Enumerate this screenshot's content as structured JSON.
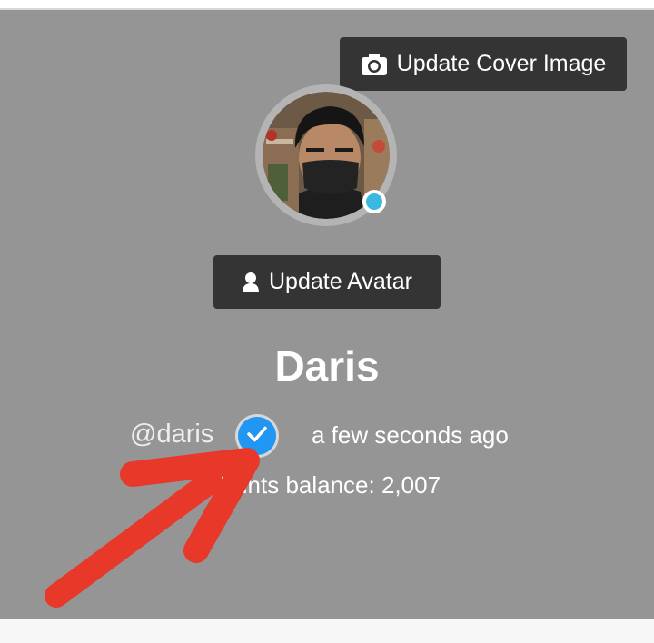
{
  "profile": {
    "display_name": "Daris",
    "handle": "@daris",
    "last_active": "a few seconds ago",
    "points_text": "Points balance: 2,007",
    "online_status": "online"
  },
  "buttons": {
    "update_cover": "Update Cover Image",
    "update_avatar": "Update Avatar"
  },
  "icons": {
    "cover_button_icon": "camera-icon",
    "avatar_button_icon": "user-icon",
    "verified_icon": "check-icon"
  },
  "colors": {
    "cover_background": "#959595",
    "button_background": "#343434",
    "verified_badge": "#2196f3",
    "online_dot": "#3bb8e0",
    "annotation_arrow": "#e8382a"
  }
}
